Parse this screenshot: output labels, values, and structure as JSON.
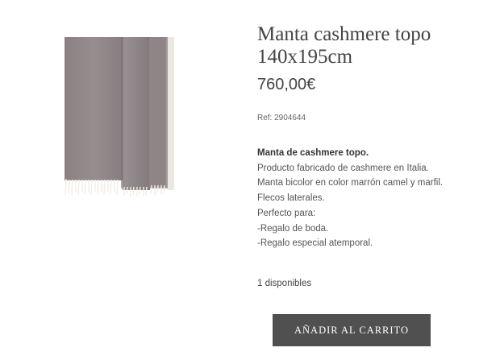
{
  "product": {
    "title": "Manta cashmere topo 140x195cm",
    "price": "760,00€",
    "reference": "Ref: 2904644",
    "image_icon": "cashmere-blanket-image",
    "colors": {
      "blanket": "#8e8486",
      "fringe": "#efece4",
      "button_bg": "#505050",
      "button_text": "#ffffff"
    }
  },
  "description": {
    "heading": "Manta de cashmere topo.",
    "lines": [
      "Producto fabricado de cashmere en Italia.",
      "Manta bicolor en color marrón camel y marfil.",
      "Flecos laterales.",
      "Perfecto para:",
      "-Regalo de boda.",
      "-Regalo especial atemporal."
    ]
  },
  "stock": {
    "label": "1 disponibles"
  },
  "cart": {
    "button_label": "AÑADIR AL CARRITO"
  }
}
